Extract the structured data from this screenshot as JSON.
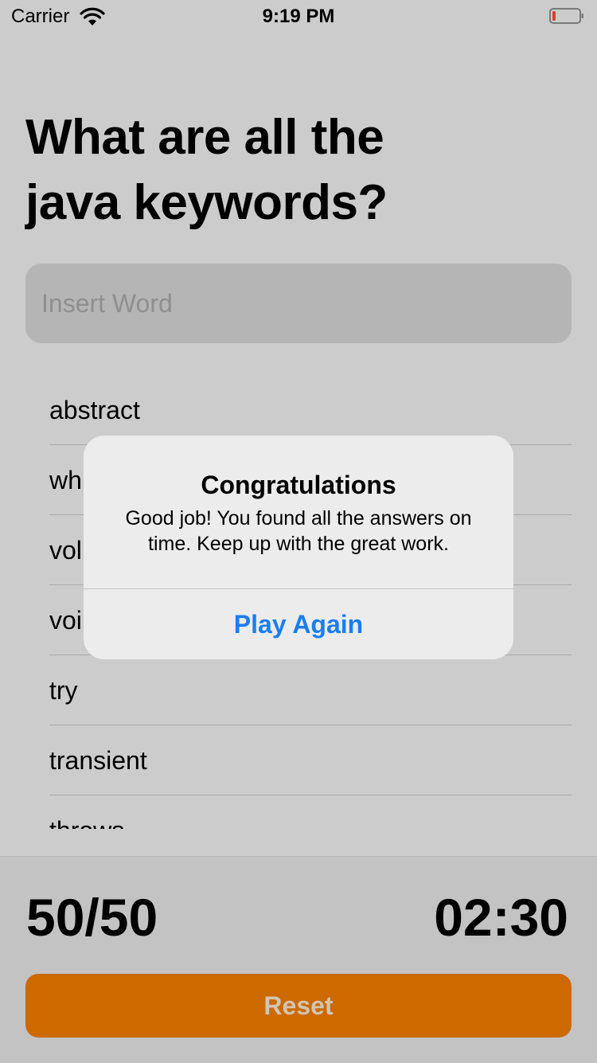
{
  "status_bar": {
    "carrier": "Carrier",
    "time": "9:19 PM"
  },
  "question": "What are all the\njava keywords?",
  "search": {
    "placeholder": "Insert Word",
    "value": ""
  },
  "answers": [
    "abstract",
    "wh",
    "vol",
    "voi",
    "try",
    "transient",
    "throws"
  ],
  "footer": {
    "score": "50/50",
    "timer": "02:30",
    "reset_label": "Reset"
  },
  "alert": {
    "title": "Congratulations",
    "message": "Good job! You found all the answers on time. Keep up with the great work.",
    "button_label": "Play Again"
  },
  "colors": {
    "accent": "#cc6a00",
    "link": "#1a7ef0",
    "battery_low": "#e53a2f"
  }
}
